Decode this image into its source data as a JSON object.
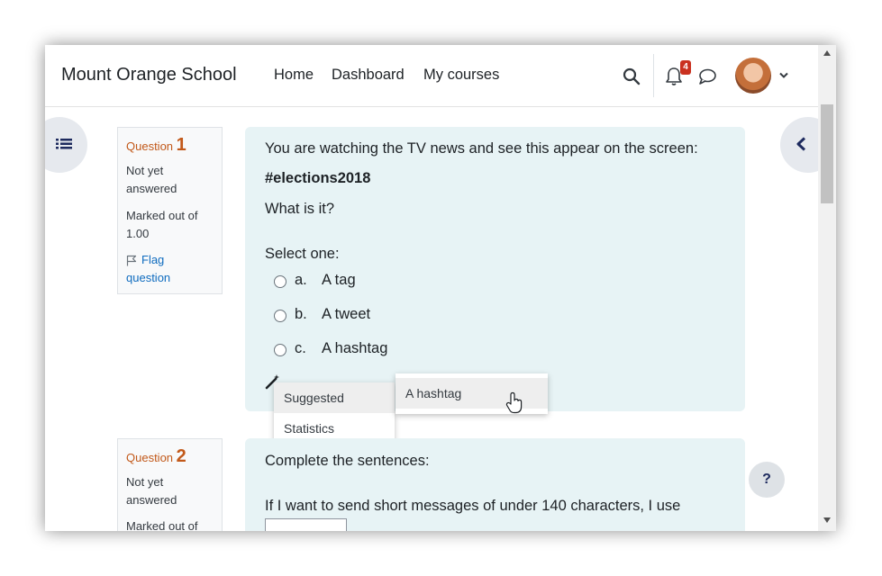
{
  "header": {
    "site_name": "Mount Orange School",
    "nav": [
      "Home",
      "Dashboard",
      "My courses"
    ],
    "notification_count": "4"
  },
  "questions": [
    {
      "label": "Question",
      "number": "1",
      "status_line1": "Not yet",
      "status_line2": "answered",
      "marked_line1": "Marked out of",
      "marked_line2": "1.00",
      "flag_line1": "Flag",
      "flag_line2": "question",
      "text": "You are watching the TV news and see this appear on the screen:",
      "hashtag": "#elections2018",
      "prompt": "What is it?",
      "select_label": "Select one:",
      "options": [
        {
          "letter": "a.",
          "text": "A tag"
        },
        {
          "letter": "b.",
          "text": "A tweet"
        },
        {
          "letter": "c.",
          "text": "A hashtag"
        }
      ]
    },
    {
      "label": "Question",
      "number": "2",
      "status_line1": "Not yet",
      "status_line2": "answered",
      "marked_line1": "Marked out of",
      "text": "Complete the sentences:",
      "sentence": "If I want to send short messages of under 140 characters, I use"
    }
  ],
  "context_menu": {
    "items": [
      "Suggested",
      "Statistics"
    ],
    "submenu": [
      "A hashtag"
    ]
  },
  "help_label": "?",
  "colors": {
    "accent": "#0f6cbf",
    "question_label": "#c2591a",
    "formulation_bg": "#e7f3f5",
    "badge": "#ca3120"
  }
}
